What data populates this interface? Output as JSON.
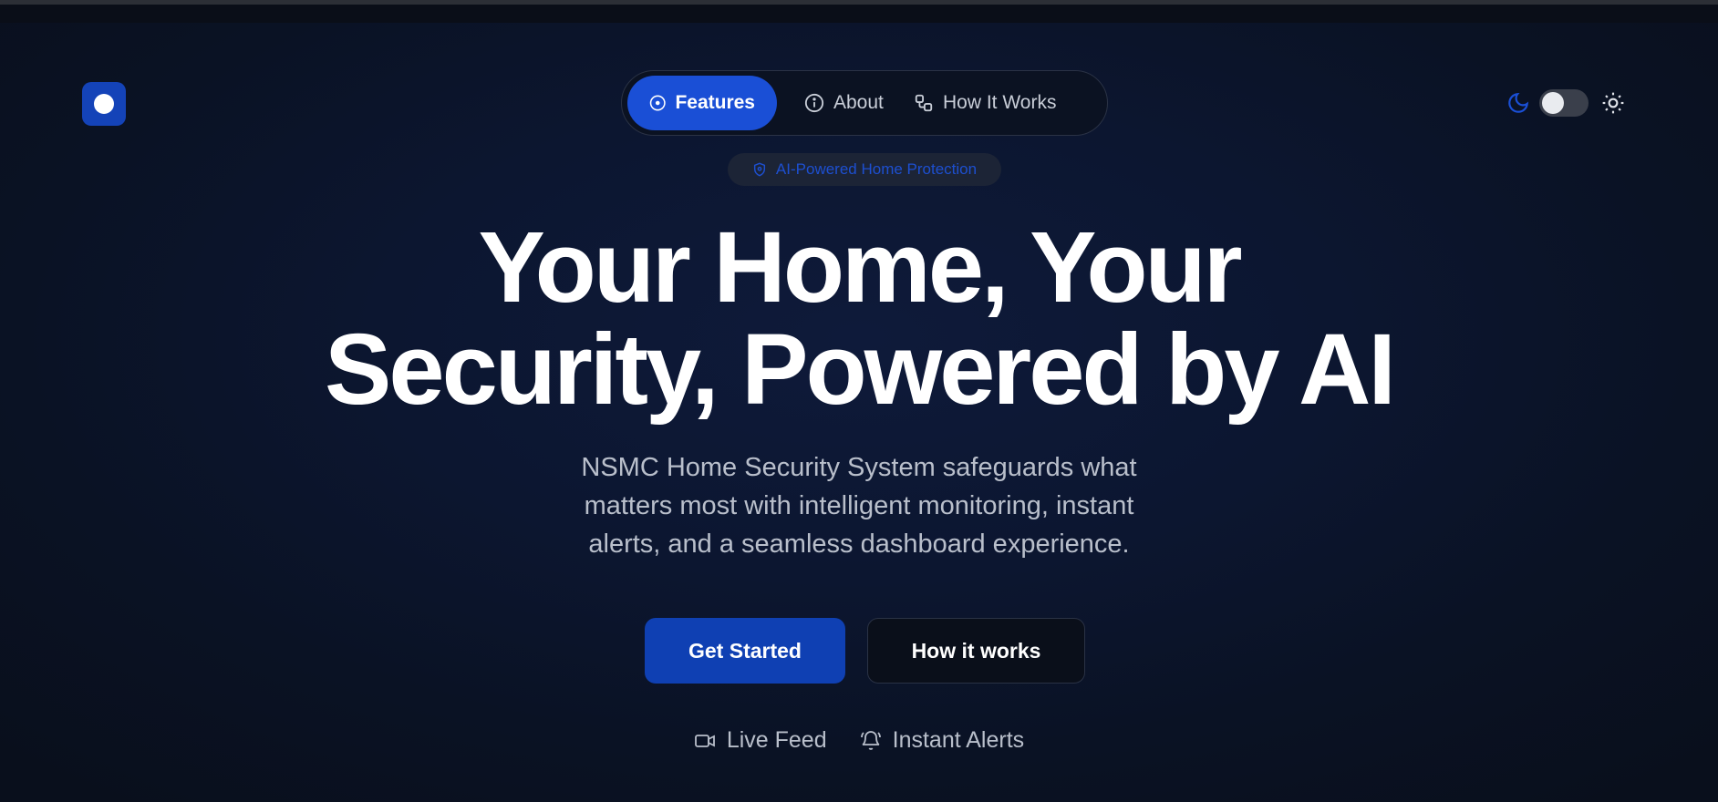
{
  "logo": {
    "icon": "circle-logo-icon"
  },
  "nav": {
    "items": [
      {
        "label": "Features",
        "icon": "target-circle-icon",
        "active": true
      },
      {
        "label": "About",
        "icon": "info-icon",
        "active": false
      },
      {
        "label": "How It Works",
        "icon": "workflow-icon",
        "active": false
      }
    ]
  },
  "theme": {
    "dark_icon": "moon-icon",
    "light_icon": "sun-icon",
    "mode": "dark"
  },
  "hero": {
    "badge": "AI-Powered Home Protection",
    "badge_icon": "shield-icon",
    "headline_line1": "Your Home, Your",
    "headline_line2": "Security, Powered by AI",
    "subtext": "NSMC Home Security System safeguards what matters most with intelligent monitoring, instant alerts, and a seamless dashboard experience.",
    "primary_button": "Get Started",
    "secondary_button": "How it works",
    "features": [
      {
        "label": "Live Feed",
        "icon": "video-camera-icon"
      },
      {
        "label": "Instant Alerts",
        "icon": "bell-icon"
      }
    ]
  },
  "colors": {
    "accent": "#1a4fd6",
    "primary_button": "#0f40b3",
    "background": "#0b1120",
    "badge_text": "#1d4fd0"
  }
}
